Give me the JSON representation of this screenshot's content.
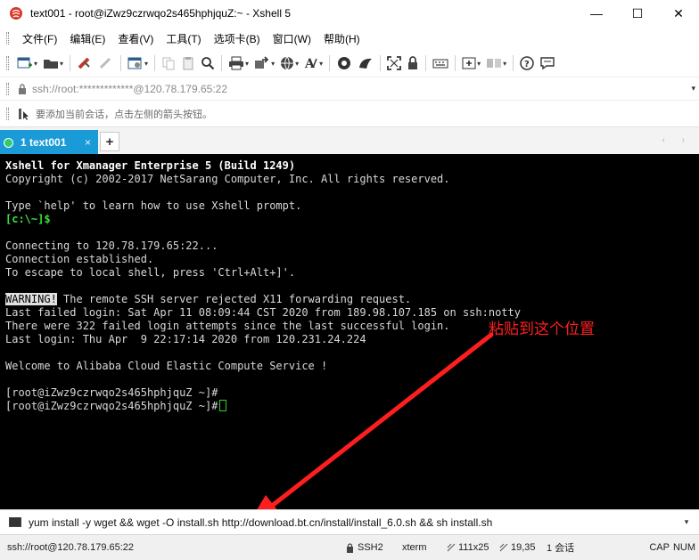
{
  "window": {
    "title": "text001 - root@iZwz9czrwqo2s465hphjquZ:~ - Xshell 5",
    "minimize": "—",
    "maximize": "☐",
    "close": "✕"
  },
  "menu": [
    "文件(F)",
    "编辑(E)",
    "查看(V)",
    "工具(T)",
    "选项卡(B)",
    "窗口(W)",
    "帮助(H)"
  ],
  "toolbar": {
    "icons": [
      "new-session-icon",
      "open-folder-icon",
      "reconnect-icon",
      "disconnect-icon",
      "properties-icon",
      "copy-icon",
      "paste-icon",
      "find-icon",
      "print-icon",
      "transfer-icon",
      "globe-icon",
      "font-icon",
      "xftp-icon",
      "xmanager-icon",
      "fullscreen-icon",
      "lock-icon",
      "keyboard-icon",
      "add-tab-icon",
      "layout-icon",
      "help-icon",
      "chat-icon"
    ]
  },
  "address": {
    "value": "ssh://root:*************@120.78.179.65:22"
  },
  "hint": {
    "text": "要添加当前会话，点击左侧的箭头按钮。"
  },
  "tabs": [
    {
      "label": "1 text001",
      "close": "×",
      "active": true
    }
  ],
  "tab_add": "+",
  "tab_nav": "‹ ›",
  "terminal": {
    "header_line1": "Xshell for Xmanager Enterprise 5 (Build 1249)",
    "header_line2": "Copyright (c) 2002-2017 NetSarang Computer, Inc. All rights reserved.",
    "help_line": "Type `help' to learn how to use Xshell prompt.",
    "local_prompt": "[c:\\~]$",
    "connect1": "Connecting to 120.78.179.65:22...",
    "connect2": "Connection established.",
    "connect3": "To escape to local shell, press 'Ctrl+Alt+]'.",
    "warning_tag": "WARNING!",
    "warning_text": " The remote SSH server rejected X11 forwarding request.",
    "failed_login": "Last failed login: Sat Apr 11 08:09:44 CST 2020 from 189.98.107.185 on ssh:notty",
    "failed_count": "There were 322 failed login attempts since the last successful login.",
    "last_login": "Last login: Thu Apr  9 22:17:14 2020 from 120.231.24.224",
    "welcome": "Welcome to Alibaba Cloud Elastic Compute Service !",
    "prompt1": "[root@iZwz9czrwqo2s465hphjquZ ~]#",
    "prompt2": "[root@iZwz9czrwqo2s465hphjquZ ~]#"
  },
  "annotation": {
    "text": "粘贴到这个位置",
    "color": "#ff1e1e"
  },
  "compose": {
    "command": "yum install -y wget && wget -O install.sh http://download.bt.cn/install/install_6.0.sh && sh install.sh",
    "dropdown": "▾"
  },
  "status": {
    "connection": "ssh://root@120.78.179.65:22",
    "protocol": "SSH2",
    "terminal_type": "xterm",
    "size": "111x25",
    "cursor_pos": "19,35",
    "sessions": "1 会话",
    "caps": "CAP",
    "num": "NUM"
  },
  "colors": {
    "tab_active": "#1a9bd7",
    "terminal_bg": "#000000",
    "prompt_green": "#3be03b"
  }
}
